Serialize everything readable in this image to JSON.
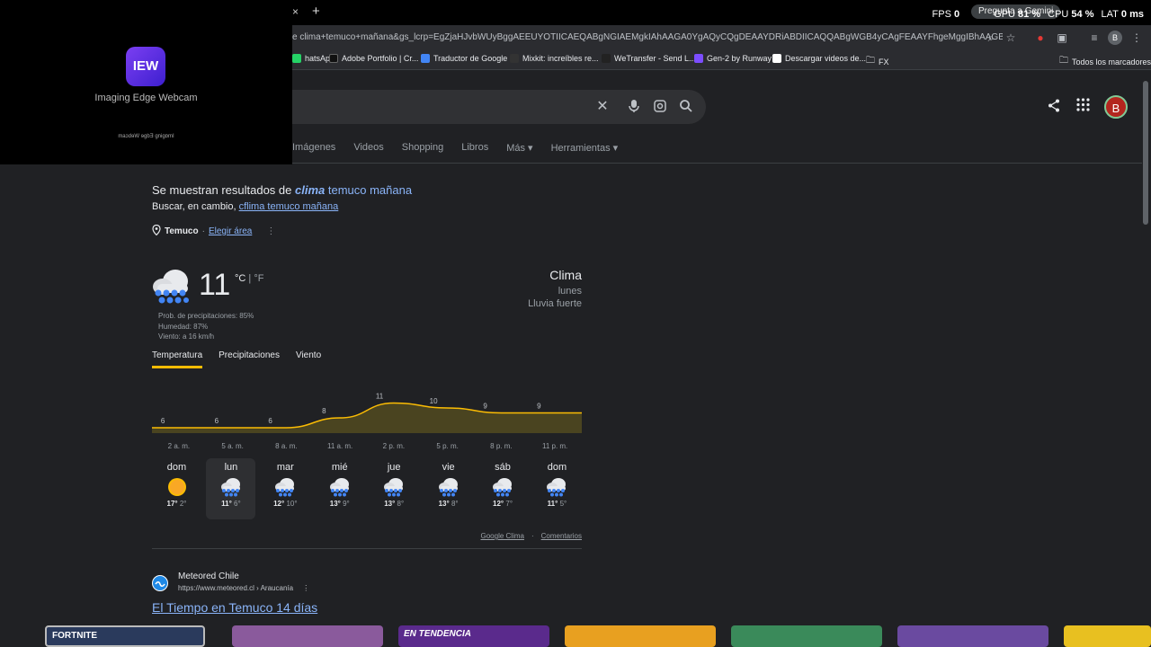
{
  "browser": {
    "url": "e clima+temuco+mañana&gs_lcrp=EgZjaHJvbWUyBggAEEUYOTIICAEQABgNGIAEMgkIAhAAGA0YgAQyCQgDEAAYDRiABDIICAQQABgWGB4yCAgFEAAYFhgeMggIBhAAGBYYHjIICAcQA",
    "new_tab_label": "+",
    "close_tab_label": "×",
    "profile_initial": "B",
    "gemini_chip": "Pregunta a Gemini",
    "perf": {
      "fps_label": "FPS",
      "fps": "0",
      "gpu_label": "GPU",
      "gpu": "81 %",
      "cpu_label": "CPU",
      "cpu": "54 %",
      "lat_label": "LAT",
      "lat": "0 ms"
    }
  },
  "bookmarks": [
    {
      "label": "hatsApp",
      "color": "#25d366"
    },
    {
      "label": "Adobe Portfolio | Cr...",
      "color": "#111111"
    },
    {
      "label": "Traductor de Google",
      "color": "#4285f4"
    },
    {
      "label": "Mixkit: increíbles re...",
      "color": "#333333"
    },
    {
      "label": "WeTransfer - Send L...",
      "color": "#222222"
    },
    {
      "label": "Gen-2 by Runway",
      "color": "#7c4dff"
    },
    {
      "label": "Descargar videos de...",
      "color": "#ffffff"
    },
    {
      "label": "FX",
      "color": "#9aa0a6"
    },
    {
      "label": "Todos los marcadores",
      "color": "#9aa0a6"
    }
  ],
  "webcam": {
    "logo_text": "IEW",
    "app_name": "Imaging Edge Webcam",
    "mirrored_text": "maɔdɘW ɘgbƎ gnigɒmI"
  },
  "search": {
    "filters": [
      "Imágenes",
      "Videos",
      "Shopping",
      "Libros",
      "Más ▾",
      "Herramientas ▾"
    ]
  },
  "results": {
    "showing_prefix": "Se muestran resultados de ",
    "showing_term": "clima",
    "showing_suffix": " temuco mañana",
    "instead_prefix": "Buscar, en cambio, ",
    "instead_link": "cflima temuco mañana",
    "location_city": "Temuco",
    "location_sep": " · ",
    "location_change": "Elegir área"
  },
  "weather": {
    "temp": "11",
    "unit_c": "°C",
    "unit_sep": " | ",
    "unit_f": "°F",
    "precip": "Prob. de precipitaciones: 85%",
    "humidity": "Humedad: 87%",
    "wind": "Viento: a 16 km/h",
    "title": "Clima",
    "day": "lunes",
    "condition": "Lluvia fuerte",
    "tabs": [
      "Temperatura",
      "Precipitaciones",
      "Viento"
    ],
    "hourly_temps": [
      6,
      6,
      6,
      8,
      11,
      10,
      9,
      9
    ],
    "hourly_times": [
      "2 a. m.",
      "5 a. m.",
      "8 a. m.",
      "11 a. m.",
      "2 p. m.",
      "5 p. m.",
      "8 p. m.",
      "11 p. m."
    ],
    "days": [
      {
        "name": "dom",
        "icon": "sun-icon",
        "hi": "17°",
        "lo": "2°"
      },
      {
        "name": "lun",
        "icon": "rain-cloud-icon",
        "hi": "11°",
        "lo": "6°"
      },
      {
        "name": "mar",
        "icon": "rain-cloud-icon",
        "hi": "12°",
        "lo": "10°"
      },
      {
        "name": "mié",
        "icon": "rain-cloud-icon",
        "hi": "13°",
        "lo": "9°"
      },
      {
        "name": "jue",
        "icon": "rain-cloud-icon",
        "hi": "13°",
        "lo": "8°"
      },
      {
        "name": "vie",
        "icon": "rain-cloud-icon",
        "hi": "13°",
        "lo": "8°"
      },
      {
        "name": "sáb",
        "icon": "rain-cloud-icon",
        "hi": "12°",
        "lo": "7°"
      },
      {
        "name": "dom",
        "icon": "rain-cloud-icon",
        "hi": "11°",
        "lo": "5°"
      }
    ],
    "footer_source": "Google Clima",
    "footer_sep": "·",
    "footer_feedback": "Comentarios",
    "chart_color": "#fbbc04"
  },
  "result2": {
    "site": "Meteored Chile",
    "cite": "https://www.meteored.cl › Araucanía",
    "title": "El Tiempo en Temuco 14 días"
  },
  "thumbs": [
    {
      "label": "FORTNITE",
      "color": "#2a3a5c"
    },
    {
      "label": "",
      "color": "#8a5a9c"
    },
    {
      "label": "EN TENDENCIA",
      "color": "#5a2a8c"
    },
    {
      "label": "",
      "color": "#e8a020"
    },
    {
      "label": "",
      "color": "#3a8a5a"
    },
    {
      "label": "",
      "color": "#6a4aa0"
    },
    {
      "label": "",
      "color": "#e8c020"
    }
  ]
}
